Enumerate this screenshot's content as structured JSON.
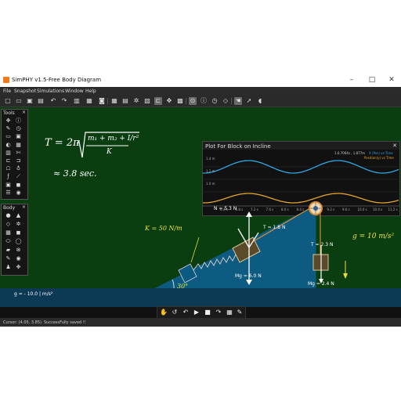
{
  "window": {
    "title": "SimPHY v1.5-Free Body Diagram",
    "minimize_icon": "minimize-icon",
    "maximize_icon": "maximize-icon",
    "close_icon": "close-icon"
  },
  "menu": [
    "File",
    "Snapshot",
    "Simulations",
    "Window",
    "Help"
  ],
  "panels": {
    "tools_title": "Tools",
    "bodies_title": "Body",
    "close_glyph": "×"
  },
  "plot": {
    "title": "Plot For Block on Incline",
    "legend": [
      "X (Pos) vs Time",
      "Position(y) vs Time"
    ],
    "readout": "1.6.7064s , 1.877m",
    "y_ticks": [
      "1.4 m",
      "1.2 m",
      "1.0 m"
    ],
    "x_ticks": [
      "6.4 s",
      "6.8 s",
      "7.2 s",
      "7.6 s",
      "8.0 s",
      "8.4 s",
      "8.8 s",
      "9.2 s",
      "9.6 s",
      "10.0 s",
      "10.4 s",
      "11.2 s"
    ],
    "colors": {
      "series1": "#2ea8e6",
      "series2": "#e6a52e"
    }
  },
  "board": {
    "formula_T": "T = 2π",
    "formula_num": "m₁ + m₂ + I/r²",
    "formula_den": "K",
    "approx": "≈ 3.8 sec.",
    "spring_label": "K = 50 N/m",
    "g_label": "g = 10 m/s²",
    "angle_label": "30°",
    "normal_force": "N = 5.3 N",
    "tension1": "T = 1.8 N",
    "weight1": "Mg = 6.0 N",
    "tension2": "T = 2.3 N",
    "weight2": "Mg = 2.4 N",
    "gravity_readout": "g = - 10.0 | m/s²"
  },
  "status": {
    "cursor": "Cursor: (4.05, 3.85)",
    "message": "SuccessFully saved !!"
  },
  "colors": {
    "board": "#0a3e11",
    "ground": "#0c3a55",
    "incline": "#0d5b80"
  }
}
